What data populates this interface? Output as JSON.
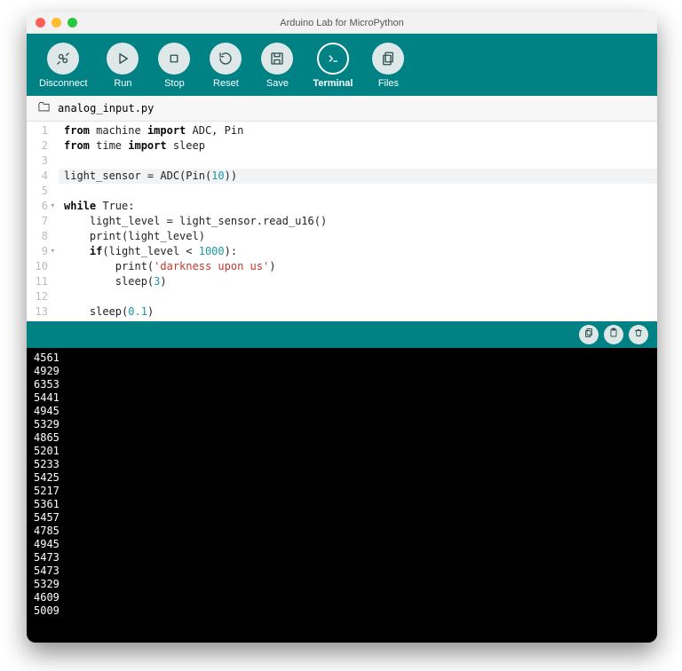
{
  "window_title": "Arduino Lab for MicroPython",
  "toolbar": [
    {
      "id": "disconnect",
      "label": "Disconnect",
      "icon": "plug",
      "active": false
    },
    {
      "id": "run",
      "label": "Run",
      "icon": "play",
      "active": false
    },
    {
      "id": "stop",
      "label": "Stop",
      "icon": "stop",
      "active": false
    },
    {
      "id": "reset",
      "label": "Reset",
      "icon": "reset",
      "active": false
    },
    {
      "id": "save",
      "label": "Save",
      "icon": "save",
      "active": false
    },
    {
      "id": "terminal",
      "label": "Terminal",
      "icon": "terminal",
      "active": true
    },
    {
      "id": "files",
      "label": "Files",
      "icon": "files",
      "active": false
    }
  ],
  "file_name": "analog_input.py",
  "code_lines": [
    {
      "n": 1,
      "fold": false,
      "hl": false,
      "tokens": [
        {
          "t": "from ",
          "c": "kw"
        },
        {
          "t": "machine ",
          "c": "plain"
        },
        {
          "t": "import ",
          "c": "kw"
        },
        {
          "t": "ADC, Pin",
          "c": "plain"
        }
      ]
    },
    {
      "n": 2,
      "fold": false,
      "hl": false,
      "tokens": [
        {
          "t": "from ",
          "c": "kw"
        },
        {
          "t": "time ",
          "c": "plain"
        },
        {
          "t": "import ",
          "c": "kw"
        },
        {
          "t": "sleep",
          "c": "plain"
        }
      ]
    },
    {
      "n": 3,
      "fold": false,
      "hl": false,
      "tokens": []
    },
    {
      "n": 4,
      "fold": false,
      "hl": true,
      "tokens": [
        {
          "t": "light_sensor = ADC(Pin(",
          "c": "plain"
        },
        {
          "t": "10",
          "c": "num"
        },
        {
          "t": "))",
          "c": "plain"
        }
      ]
    },
    {
      "n": 5,
      "fold": false,
      "hl": false,
      "tokens": []
    },
    {
      "n": 6,
      "fold": true,
      "hl": false,
      "tokens": [
        {
          "t": "while ",
          "c": "kw"
        },
        {
          "t": "True:",
          "c": "plain"
        }
      ]
    },
    {
      "n": 7,
      "fold": false,
      "hl": false,
      "tokens": [
        {
          "t": "    light_level = light_sensor.read_u16()",
          "c": "plain"
        }
      ]
    },
    {
      "n": 8,
      "fold": false,
      "hl": false,
      "tokens": [
        {
          "t": "    print(light_level)",
          "c": "plain"
        }
      ]
    },
    {
      "n": 9,
      "fold": true,
      "hl": false,
      "tokens": [
        {
          "t": "    ",
          "c": "plain"
        },
        {
          "t": "if",
          "c": "kw"
        },
        {
          "t": "(light_level < ",
          "c": "plain"
        },
        {
          "t": "1000",
          "c": "num"
        },
        {
          "t": "):",
          "c": "plain"
        }
      ]
    },
    {
      "n": 10,
      "fold": false,
      "hl": false,
      "tokens": [
        {
          "t": "        print(",
          "c": "plain"
        },
        {
          "t": "'darkness upon us'",
          "c": "str"
        },
        {
          "t": ")",
          "c": "plain"
        }
      ]
    },
    {
      "n": 11,
      "fold": false,
      "hl": false,
      "tokens": [
        {
          "t": "        sleep(",
          "c": "plain"
        },
        {
          "t": "3",
          "c": "num"
        },
        {
          "t": ")",
          "c": "plain"
        }
      ]
    },
    {
      "n": 12,
      "fold": false,
      "hl": false,
      "tokens": []
    },
    {
      "n": 13,
      "fold": false,
      "hl": false,
      "tokens": [
        {
          "t": "    sleep(",
          "c": "plain"
        },
        {
          "t": "0.1",
          "c": "num"
        },
        {
          "t": ")",
          "c": "plain"
        }
      ]
    }
  ],
  "terminal_output": [
    "4561",
    "4929",
    "6353",
    "5441",
    "4945",
    "5329",
    "4865",
    "5201",
    "5233",
    "5425",
    "5217",
    "5361",
    "5457",
    "4785",
    "4945",
    "5473",
    "5473",
    "5329",
    "4609",
    "5009"
  ],
  "term_buttons": [
    {
      "id": "copy",
      "icon": "copy"
    },
    {
      "id": "paste",
      "icon": "clipboard"
    },
    {
      "id": "clear",
      "icon": "trash"
    }
  ]
}
